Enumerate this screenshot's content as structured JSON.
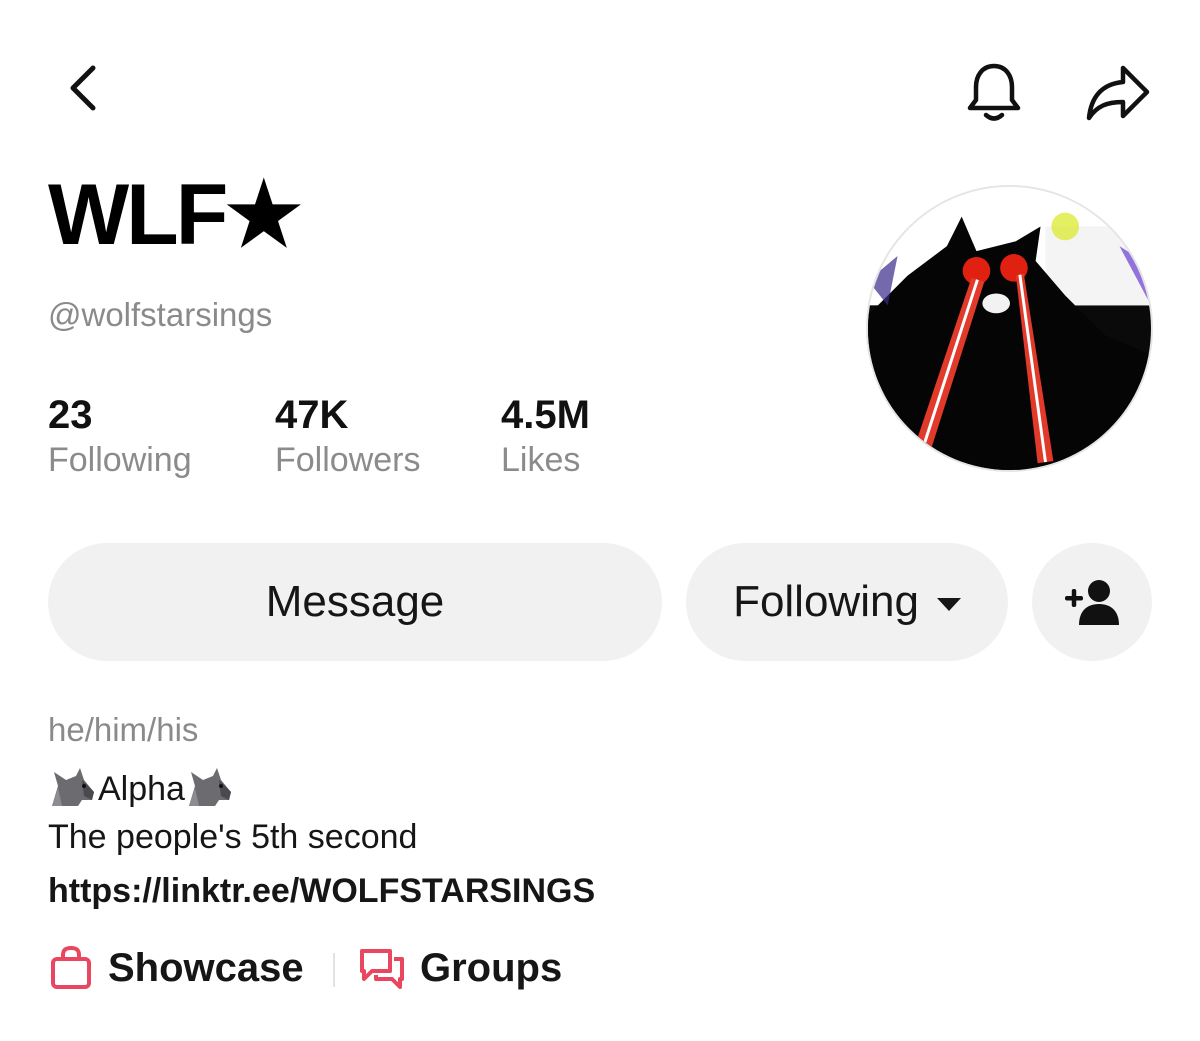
{
  "header": {
    "back_icon": "chevron-left-icon",
    "bell_icon": "bell-icon",
    "share_icon": "share-arrow-icon"
  },
  "profile": {
    "display_name": "WLF★",
    "handle": "@wolfstarsings"
  },
  "stats": [
    {
      "value": "23",
      "label": "Following"
    },
    {
      "value": "47K",
      "label": "Followers"
    },
    {
      "value": "4.5M",
      "label": "Likes"
    }
  ],
  "actions": {
    "message_label": "Message",
    "following_label": "Following",
    "add_friend_icon": "add-person-icon"
  },
  "bio": {
    "pronouns": "he/him/his",
    "line1": "Alpha",
    "line1_emoji": "wolf-emoji",
    "line2": "The people's 5th second",
    "link": "https://linktr.ee/WOLFSTARSINGS"
  },
  "tags": {
    "showcase_label": "Showcase",
    "groups_label": "Groups"
  },
  "colors": {
    "accent": "#e8475f",
    "button_bg": "#f1f1f2",
    "muted_text": "#8a8a8a"
  }
}
